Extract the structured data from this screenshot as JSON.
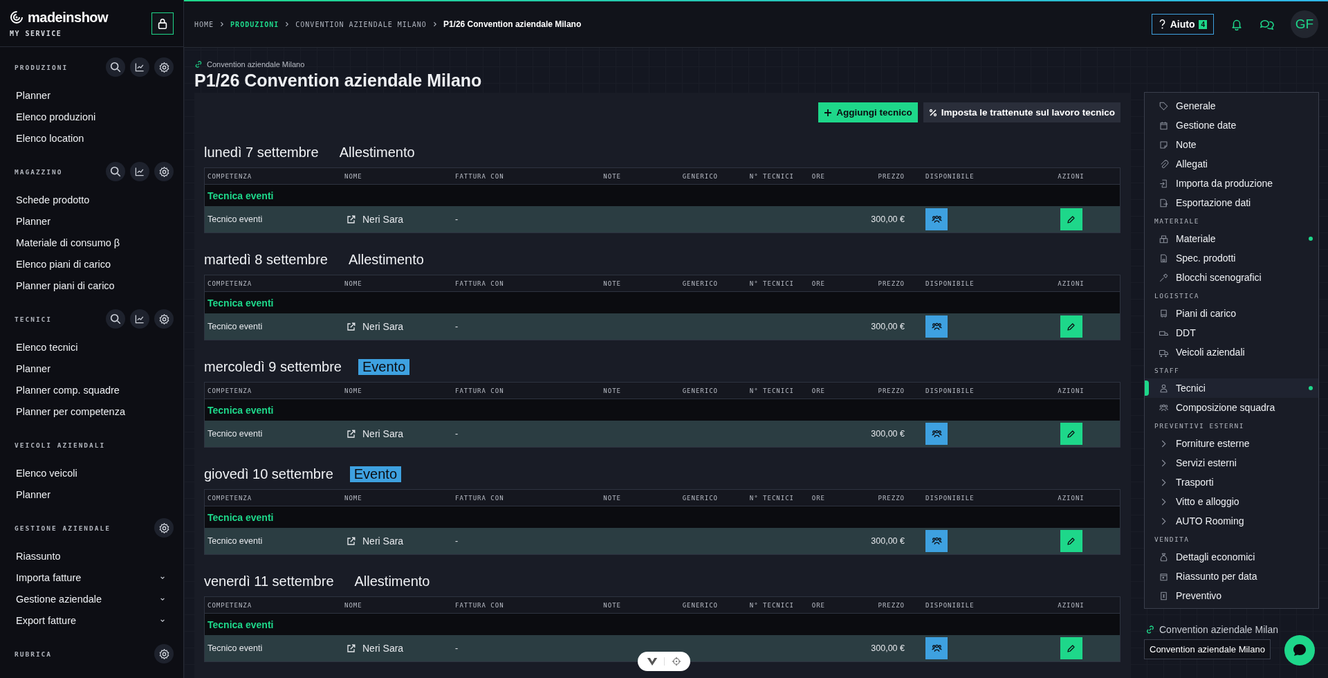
{
  "brand": {
    "name": "madeinshow",
    "subtitle": "MY SERVICE"
  },
  "sidebar": {
    "sections": [
      {
        "title": "PRODUZIONI",
        "kind": "full",
        "items": [
          {
            "label": "Planner",
            "expandable": false
          },
          {
            "label": "Elenco produzioni",
            "expandable": false
          },
          {
            "label": "Elenco location",
            "expandable": false
          }
        ]
      },
      {
        "title": "MAGAZZINO",
        "kind": "full",
        "items": [
          {
            "label": "Schede prodotto",
            "expandable": false
          },
          {
            "label": "Planner",
            "expandable": false
          },
          {
            "label": "Materiale di consumo β",
            "expandable": false
          },
          {
            "label": "Elenco piani di carico",
            "expandable": false
          },
          {
            "label": "Planner piani di carico",
            "expandable": false
          }
        ]
      },
      {
        "title": "TECNICI",
        "kind": "full",
        "items": [
          {
            "label": "Elenco tecnici",
            "expandable": false
          },
          {
            "label": "Planner",
            "expandable": false
          },
          {
            "label": "Planner comp. squadre",
            "expandable": false
          },
          {
            "label": "Planner per competenza",
            "expandable": false
          }
        ]
      },
      {
        "title": "VEICOLI AZIENDALI",
        "kind": "plain",
        "items": [
          {
            "label": "Elenco veicoli",
            "expandable": false
          },
          {
            "label": "Planner",
            "expandable": false
          }
        ]
      },
      {
        "title": "GESTIONE AZIENDALE",
        "kind": "settings",
        "items": [
          {
            "label": "Riassunto",
            "expandable": false
          },
          {
            "label": "Importa fatture",
            "expandable": true
          },
          {
            "label": "Gestione aziendale",
            "expandable": true
          },
          {
            "label": "Export fatture",
            "expandable": true
          }
        ]
      },
      {
        "title": "RUBRICA",
        "kind": "settings"
      }
    ]
  },
  "breadcrumb": [
    {
      "label": "HOME",
      "current": false,
      "active": false
    },
    {
      "label": "PRODUZIONI",
      "current": false,
      "active": true
    },
    {
      "label": "CONVENTION AZIENDALE MILANO",
      "current": false,
      "active": false
    },
    {
      "label": "P1/26 Convention aziendale Milano",
      "current": true,
      "active": false
    }
  ],
  "header": {
    "help_label": "Aiuto",
    "help_count": "4",
    "avatar": "GF"
  },
  "page": {
    "parent_link": "Convention aziendale Milano",
    "title": "P1/26 Convention aziendale Milano"
  },
  "actions": [
    "Aggiungi tecnico",
    "Imposta le trattenute sul lavoro tecnico"
  ],
  "days": [
    {
      "date": "lunedì 7 settembre",
      "phase": "Allestimento",
      "highlighted": false,
      "columns": [
        "COMPETENZA",
        "NOME",
        "FATTURA CON",
        "NOTE",
        "GENERICO",
        "N° TECNICI",
        "ORE",
        "PREZZO",
        "DISPONIBILE",
        "AZIONI"
      ],
      "group": "Tecnica eventi",
      "rows": [
        {
          "competenza": "Tecnico eventi",
          "nome": "Neri Sara",
          "fattura_con": "-",
          "prezzo": "300,00 €"
        }
      ]
    },
    {
      "date": "martedì 8 settembre",
      "phase": "Allestimento",
      "highlighted": false,
      "columns": [
        "COMPETENZA",
        "NOME",
        "FATTURA CON",
        "NOTE",
        "GENERICO",
        "N° TECNICI",
        "ORE",
        "PREZZO",
        "DISPONIBILE",
        "AZIONI"
      ],
      "group": "Tecnica eventi",
      "rows": [
        {
          "competenza": "Tecnico eventi",
          "nome": "Neri Sara",
          "fattura_con": "-",
          "prezzo": "300,00 €"
        }
      ]
    },
    {
      "date": "mercoledì 9 settembre",
      "phase": "Evento",
      "highlighted": true,
      "columns": [
        "COMPETENZA",
        "NOME",
        "FATTURA CON",
        "NOTE",
        "GENERICO",
        "N° TECNICI",
        "ORE",
        "PREZZO",
        "DISPONIBILE",
        "AZIONI"
      ],
      "group": "Tecnica eventi",
      "rows": [
        {
          "competenza": "Tecnico eventi",
          "nome": "Neri Sara",
          "fattura_con": "-",
          "prezzo": "300,00 €"
        }
      ]
    },
    {
      "date": "giovedì 10 settembre",
      "phase": "Evento",
      "highlighted": true,
      "columns": [
        "COMPETENZA",
        "NOME",
        "FATTURA CON",
        "NOTE",
        "GENERICO",
        "N° TECNICI",
        "ORE",
        "PREZZO",
        "DISPONIBILE",
        "AZIONI"
      ],
      "group": "Tecnica eventi",
      "rows": [
        {
          "competenza": "Tecnico eventi",
          "nome": "Neri Sara",
          "fattura_con": "-",
          "prezzo": "300,00 €"
        }
      ]
    },
    {
      "date": "venerdì 11 settembre",
      "phase": "Allestimento",
      "highlighted": false,
      "columns": [
        "COMPETENZA",
        "NOME",
        "FATTURA CON",
        "NOTE",
        "GENERICO",
        "N° TECNICI",
        "ORE",
        "PREZZO",
        "DISPONIBILE",
        "AZIONI"
      ],
      "group": "Tecnica eventi",
      "rows": [
        {
          "competenza": "Tecnico eventi",
          "nome": "Neri Sara",
          "fattura_con": "-",
          "prezzo": "300,00 €"
        }
      ]
    }
  ],
  "nav": {
    "sections": [
      {
        "items": [
          {
            "label": "Generale",
            "kind": "page",
            "selected": false,
            "dot": false
          },
          {
            "label": "Gestione date",
            "kind": "page",
            "selected": false,
            "dot": false
          },
          {
            "label": "Note",
            "kind": "page",
            "selected": false,
            "dot": false
          },
          {
            "label": "Allegati",
            "kind": "page",
            "selected": false,
            "dot": false
          },
          {
            "label": "Importa da produzione",
            "kind": "page",
            "selected": false,
            "dot": false
          },
          {
            "label": "Esportazione dati",
            "kind": "page",
            "selected": false,
            "dot": false
          }
        ]
      },
      {
        "title": "MATERIALE",
        "items": [
          {
            "label": "Materiale",
            "kind": "page",
            "selected": false,
            "dot": true
          },
          {
            "label": "Spec. prodotti",
            "kind": "page",
            "selected": false,
            "dot": false
          },
          {
            "label": "Blocchi scenografici",
            "kind": "page",
            "selected": false,
            "dot": false
          }
        ]
      },
      {
        "title": "LOGISTICA",
        "items": [
          {
            "label": "Piani di carico",
            "kind": "page",
            "selected": false,
            "dot": false
          },
          {
            "label": "DDT",
            "kind": "page",
            "selected": false,
            "dot": false
          },
          {
            "label": "Veicoli aziendali",
            "kind": "page",
            "selected": false,
            "dot": false
          }
        ]
      },
      {
        "title": "STAFF",
        "items": [
          {
            "label": "Tecnici",
            "kind": "page",
            "selected": true,
            "dot": true
          },
          {
            "label": "Composizione squadra",
            "kind": "page",
            "selected": false,
            "dot": false
          }
        ]
      },
      {
        "title": "PREVENTIVI ESTERNI",
        "items": [
          {
            "label": "Forniture esterne",
            "kind": "expandable",
            "selected": false,
            "dot": false
          },
          {
            "label": "Servizi esterni",
            "kind": "expandable",
            "selected": false,
            "dot": false
          },
          {
            "label": "Trasporti",
            "kind": "expandable",
            "selected": false,
            "dot": false
          },
          {
            "label": "Vitto e alloggio",
            "kind": "expandable",
            "selected": false,
            "dot": false
          },
          {
            "label": "AUTO Rooming",
            "kind": "expandable",
            "selected": false,
            "dot": false
          }
        ]
      },
      {
        "title": "VENDITA",
        "items": [
          {
            "label": "Dettagli economici",
            "kind": "page",
            "selected": false,
            "dot": false
          },
          {
            "label": "Riassunto per data",
            "kind": "page",
            "selected": false,
            "dot": false
          },
          {
            "label": "Preventivo",
            "kind": "page",
            "selected": false,
            "dot": false
          }
        ]
      }
    ]
  },
  "project_select": {
    "label": "Convention aziendale Milan",
    "value": "Convention aziendale Milano"
  }
}
